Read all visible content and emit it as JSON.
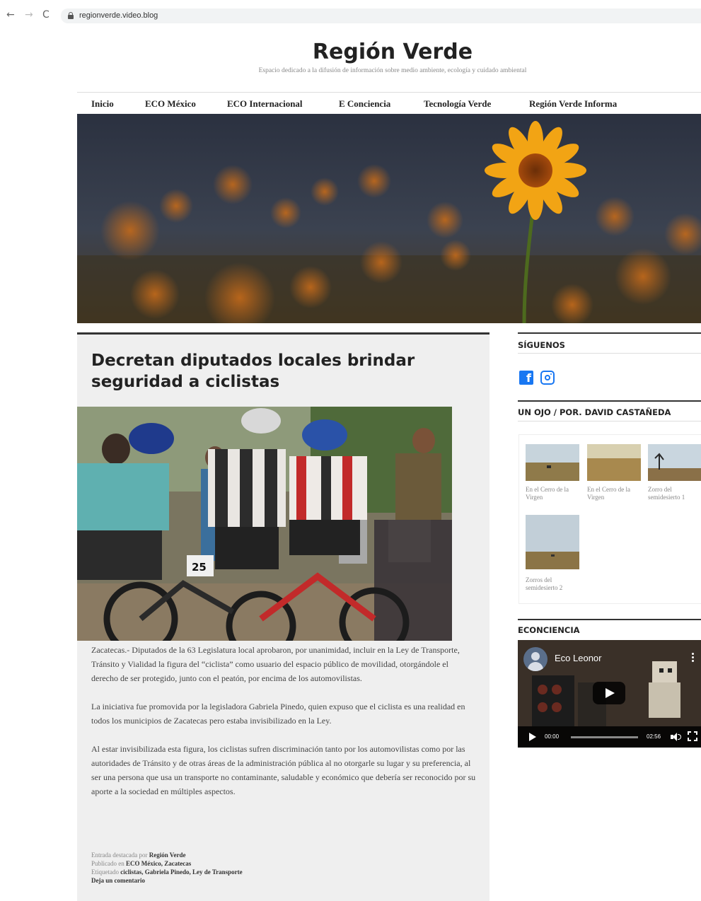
{
  "browser": {
    "url": "regionverde.video.blog"
  },
  "site": {
    "title": "Región Verde",
    "tagline": "Espacio dedicado a la difusión de información sobre medio ambiente, ecología y cuidado ambiental"
  },
  "menu": {
    "items": [
      {
        "label": "Inicio"
      },
      {
        "label": "ECO México"
      },
      {
        "label": "ECO Internacional"
      },
      {
        "label": "E Conciencia"
      },
      {
        "label": "Tecnología Verde"
      },
      {
        "label": "Región Verde Informa"
      }
    ]
  },
  "post": {
    "title": "Decretan diputados locales brindar seguridad a ciclistas",
    "paragraphs": [
      "Zacatecas.- Diputados de la 63 Legislatura local aprobaron, por unanimidad, incluir en la Ley de Transporte, Tránsito y Vialidad la figura del “ciclista” como usuario del espacio público de movilidad, otorgándole el derecho de ser protegido, junto con el peatón, por encima de los automovilistas.",
      "La iniciativa fue promovida por la legisladora Gabriela Pinedo, quien expuso que el ciclista es una realidad en todos los municipios de Zacatecas pero estaba invisibilizado en la Ley.",
      "Al estar invisibilizada esta figura, los ciclistas sufren discriminación tanto por los automovilistas como por las autoridades de Tránsito y de otras áreas de la administración pública al no otorgarle su lugar y su preferencia, al ser una persona que usa un transporte no contaminante, saludable y económico que debería ser reconocido por su aporte a la sociedad en múltiples aspectos."
    ],
    "meta": {
      "featured_prefix": "Entrada destacada por",
      "author": "Región Verde",
      "published_prefix": "Publicado en",
      "categories": "ECO México, Zacatecas",
      "tagged_prefix": "Etiquetado",
      "tags": "ciclistas, Gabriela Pinedo, Ley de Transporte",
      "comment_link": "Deja un comentario"
    }
  },
  "sidebar": {
    "follow": {
      "title": "SÍGUENOS",
      "icons": [
        "facebook-icon",
        "instagram-icon"
      ]
    },
    "gallery": {
      "title": "UN OJO / POR. DAVID CASTAÑEDA",
      "items": [
        {
          "caption": "En el Cerro de la Virgen"
        },
        {
          "caption": "En el Cerro de la Virgen"
        },
        {
          "caption": "Zorro del semidesierto 1"
        },
        {
          "caption": "Zorros del semidesierto 2"
        }
      ]
    },
    "econciencia": {
      "title": "ECONCIENCIA",
      "video_title": "Eco Leonor",
      "time_current": "00:00",
      "time_total": "02:56"
    }
  },
  "colors": {
    "accent": "#1877f2",
    "article_bg": "#efefef",
    "rule": "#333333"
  }
}
